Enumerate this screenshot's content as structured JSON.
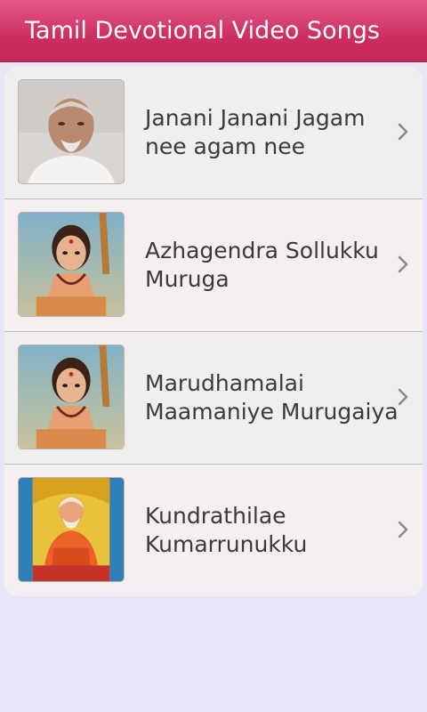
{
  "app": {
    "title": "Tamil Devotional Video Songs"
  },
  "songs": [
    {
      "title": "Janani Janani Jagam nee agam nee",
      "thumbnail": "portrait-photo"
    },
    {
      "title": "Azhagendra Sollukku Muruga",
      "thumbnail": "murugan-painting"
    },
    {
      "title": "Marudhamalai Maamaniye Murugaiya",
      "thumbnail": "murugan-painting"
    },
    {
      "title": "Kundrathilae Kumarrunukku",
      "thumbnail": "saint-shrine-painting"
    }
  ],
  "icons": {
    "row_chevron": "chevron-right-icon"
  },
  "colors": {
    "header": "#cc2e5f",
    "background": "#e8e6f6",
    "row_gray": "#efefef",
    "row_pink": "#f6eff0",
    "text": "#3a3a3a",
    "chevron": "#8a8a8a"
  }
}
